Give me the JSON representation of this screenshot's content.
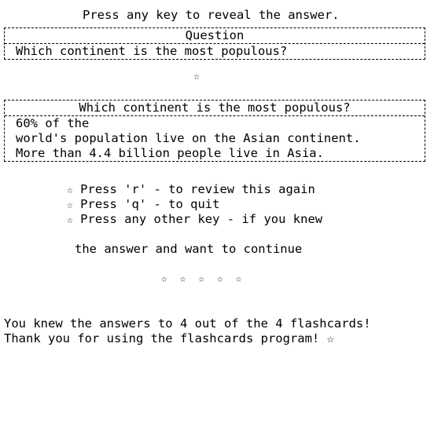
{
  "prompt": "Press any key to reveal the answer.",
  "question_table": {
    "header": "Question",
    "question": "Which continent is the most populous?"
  },
  "divider_star": "☆",
  "answer_table": {
    "header": "Which continent is the most populous?",
    "answer_lines": [
      "60% of the",
      "world's population live on the Asian continent.",
      "More than 4.4 billion people live in Asia."
    ]
  },
  "menu": {
    "bullet": "☆",
    "items": [
      "Press 'r' - to review this again",
      "Press 'q' - to quit",
      "Press any other key - if you knew"
    ],
    "continuation": "the answer and want to continue"
  },
  "stars_row": "☆ ☆ ☆ ☆ ☆",
  "summary": {
    "result": "You knew the answers to 4 out of the 4 flashcards!",
    "thanks": "Thank you for using the flashcards program! ☆"
  }
}
